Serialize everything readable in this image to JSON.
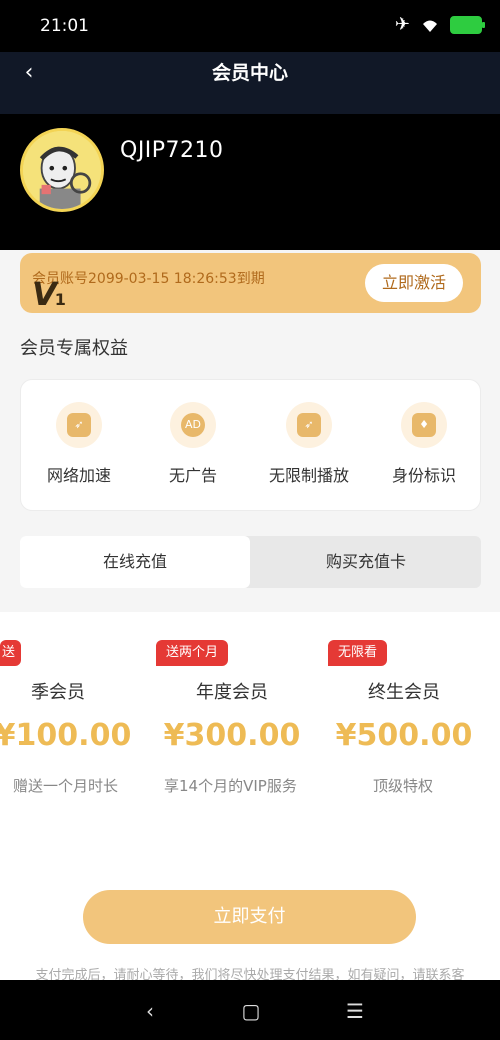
{
  "status_bar": {
    "time": "21:01"
  },
  "nav": {
    "title": "会员中心"
  },
  "profile": {
    "username": "QJIP7210"
  },
  "member_card": {
    "expire_text": "会员账号2099-03-15 18:26:53到期",
    "badge": "V",
    "badge_level": "1",
    "activate_label": "立即激活"
  },
  "benefits": {
    "title": "会员专属权益",
    "items": [
      {
        "label": "网络加速",
        "icon": "rocket-icon"
      },
      {
        "label": "无广告",
        "icon": "no-ad-icon"
      },
      {
        "label": "无限制播放",
        "icon": "rocket-icon"
      },
      {
        "label": "身份标识",
        "icon": "diamond-icon"
      }
    ]
  },
  "tabs": [
    {
      "label": "在线充值",
      "active": true
    },
    {
      "label": "购买充值卡",
      "active": false
    }
  ],
  "plans": [
    {
      "tag": "送",
      "name": "季会员",
      "price": "¥100.00",
      "desc": "赠送一个月时长"
    },
    {
      "tag": "送两个月",
      "name": "年度会员",
      "price": "¥300.00",
      "desc": "享14个月的VIP服务"
    },
    {
      "tag": "无限看",
      "name": "终生会员",
      "price": "¥500.00",
      "desc": "顶级特权"
    }
  ],
  "pay_button": "立即支付",
  "footnote": "支付完成后，请耐心等待，我们将尽快处理支付结果，如有疑问，请联系客",
  "colors": {
    "gold": "#f2c57c",
    "price": "#eebb55",
    "tag": "#e53935",
    "nav": "#111827"
  }
}
